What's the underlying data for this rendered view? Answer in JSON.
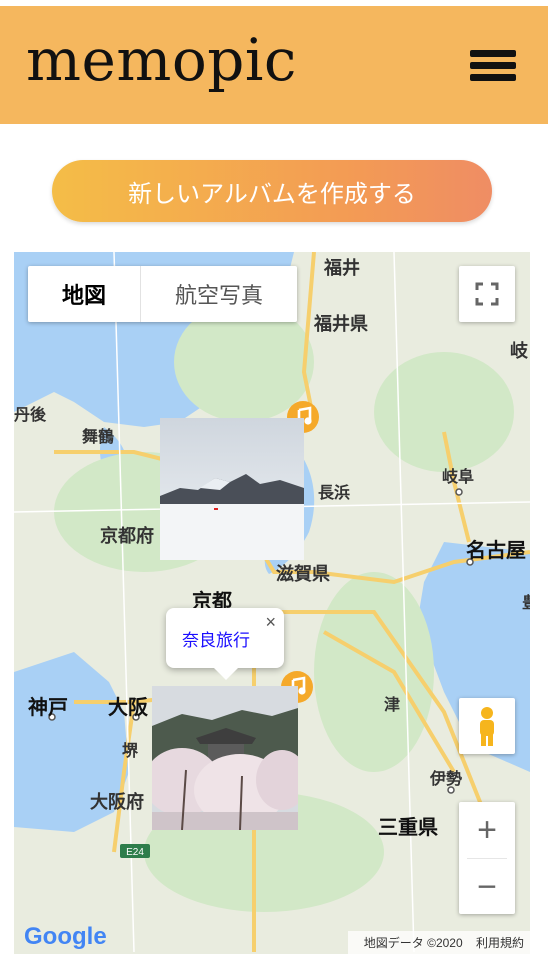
{
  "header": {
    "brand": "memopic"
  },
  "cta": {
    "label": "新しいアルバムを作成する"
  },
  "map": {
    "maptype": {
      "map": "地図",
      "satellite": "航空写真"
    },
    "places": {
      "fukui_top": "福井",
      "fukui_pref": "福井県",
      "gi_edge": "岐",
      "tango": "丹後",
      "maizuru": "舞鶴",
      "nagahama": "長浜",
      "gifu": "岐阜",
      "kyotofu": "京都府",
      "nagoya": "名古屋",
      "shiga": "滋賀県",
      "kyoto": "京都",
      "kobe": "神戸",
      "osaka": "大阪",
      "sakai": "堺",
      "tsu": "津",
      "ise": "伊勢",
      "osakafu": "大阪府",
      "mie": "三重県",
      "e24": "E24",
      "toyo": "豊"
    },
    "infowindow": {
      "title": "奈良旅行",
      "close": "×"
    },
    "zoom": {
      "in": "+",
      "out": "−"
    },
    "attribution": {
      "data": "地図データ ©2020",
      "terms": "利用規約"
    },
    "logo": "Google",
    "markers": [
      "music-marker",
      "music-marker"
    ],
    "colors": {
      "water": "#a9d0f5",
      "land": "#e9ecdf",
      "forest": "#cfe6c4",
      "road": "#f6cf6d",
      "marker": "#f5a92a",
      "header": "#f5b75e",
      "pegman": "#f6b51d"
    }
  }
}
